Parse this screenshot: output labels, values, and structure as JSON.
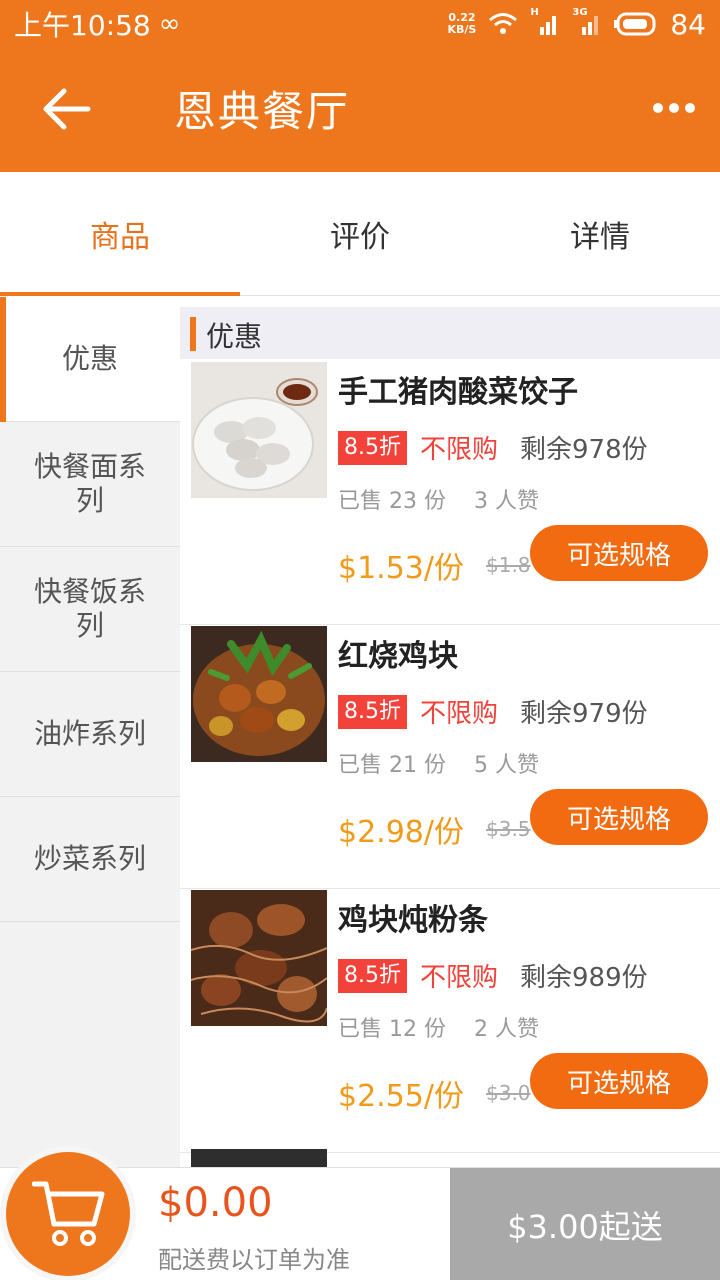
{
  "status_bar": {
    "time": "上午10:58",
    "loop_glyph": "∞",
    "net_speed_value": "0.22",
    "net_speed_unit": "KB/S",
    "sig1_tag": "H",
    "sig2_tag": "3G",
    "battery_level": "84"
  },
  "header": {
    "title": "恩典餐厅",
    "icons": [
      "back-arrow-icon",
      "more-icon"
    ]
  },
  "tabs": [
    {
      "label": "商品",
      "active": true
    },
    {
      "label": "评价",
      "active": false
    },
    {
      "label": "详情",
      "active": false
    }
  ],
  "sidebar": {
    "items": [
      {
        "label": "优惠",
        "active": true
      },
      {
        "label": "快餐面系列",
        "active": false
      },
      {
        "label": "快餐饭系列",
        "active": false
      },
      {
        "label": "油炸系列",
        "active": false
      },
      {
        "label": "炒菜系列",
        "active": false
      }
    ]
  },
  "section": {
    "title": "优惠"
  },
  "items": [
    {
      "name": "手工猪肉酸菜饺子",
      "discount": "8.5折",
      "limit": "不限购",
      "stock": "剩余978份",
      "sold": "已售 23 份",
      "likes": "3 人赞",
      "price": "$1.53/份",
      "old_price": "$1.8",
      "button": "可选规格"
    },
    {
      "name": "红烧鸡块",
      "discount": "8.5折",
      "limit": "不限购",
      "stock": "剩余979份",
      "sold": "已售 21 份",
      "likes": "5 人赞",
      "price": "$2.98/份",
      "old_price": "$3.5",
      "button": "可选规格"
    },
    {
      "name": "鸡块炖粉条",
      "discount": "8.5折",
      "limit": "不限购",
      "stock": "剩余989份",
      "sold": "已售 12 份",
      "likes": "2 人赞",
      "price": "$2.55/份",
      "old_price": "$3.0",
      "button": "可选规格"
    }
  ],
  "bottom_bar": {
    "total": "$0.00",
    "fee_note": "配送费以订单为准",
    "checkout": "$3.00起送"
  },
  "colors": {
    "accent": "#ee761c",
    "discount_red": "#f2423a",
    "price_orange": "#f29a1a",
    "button_orange": "#f36b11",
    "checkout_gray": "#a9a9a9"
  }
}
